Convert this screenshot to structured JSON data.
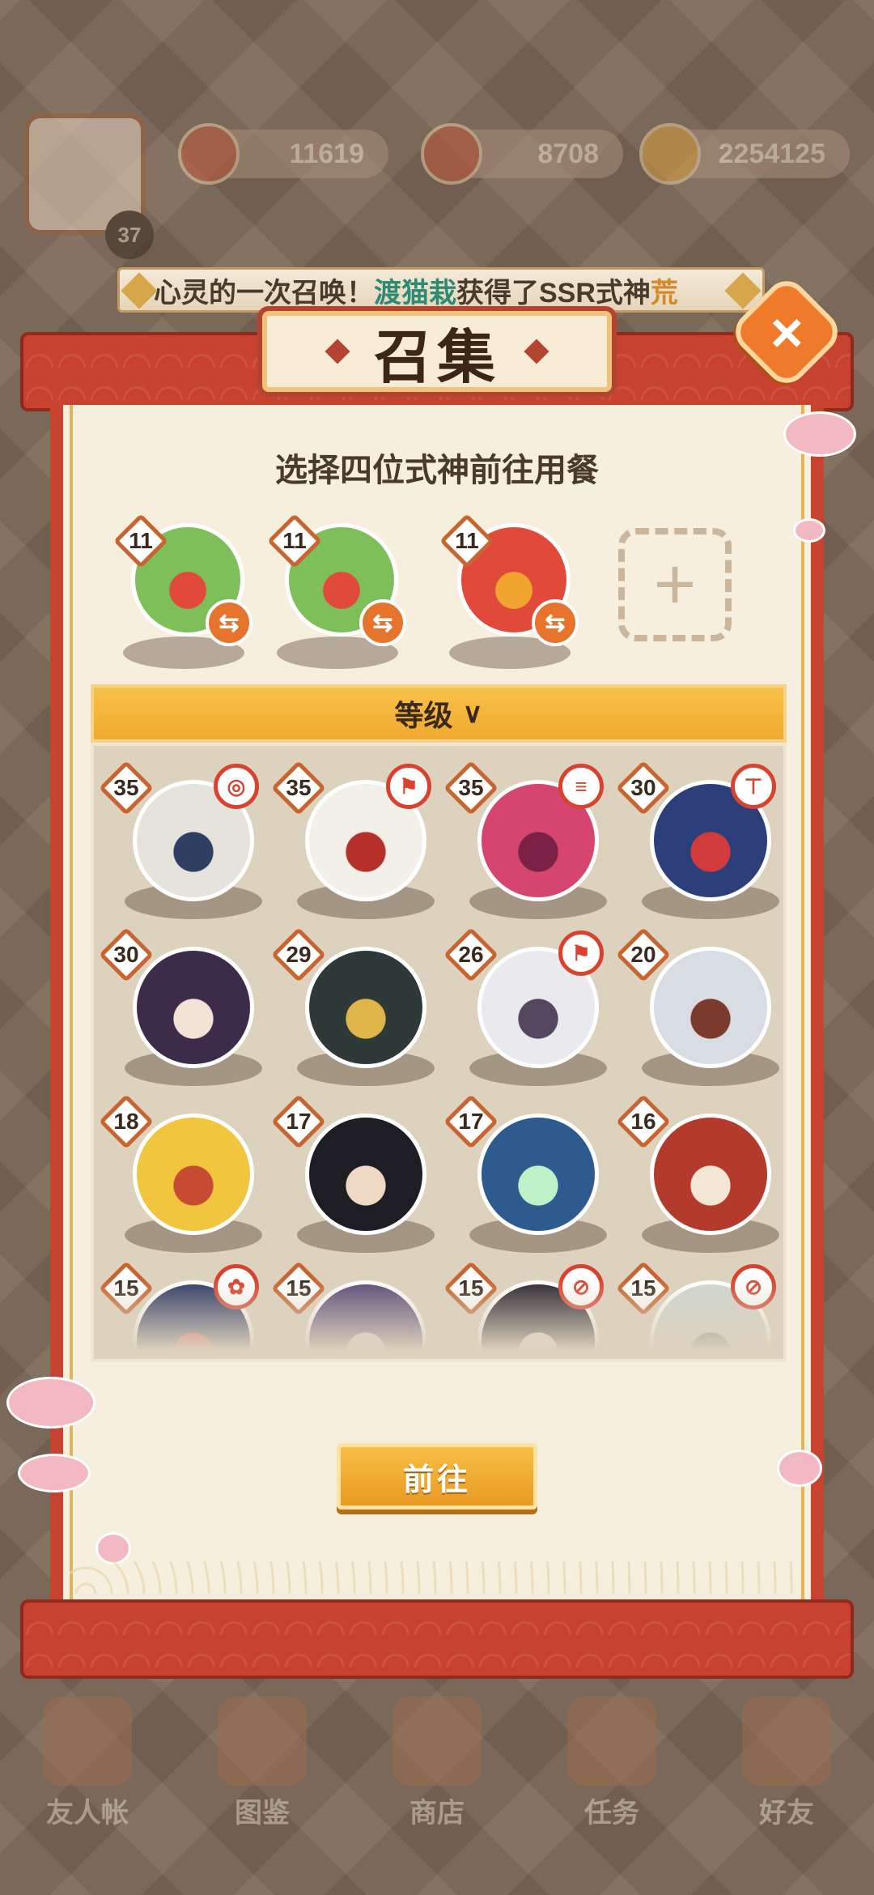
{
  "hud": {
    "level": "37",
    "currency_1": "11619",
    "currency_2": "8708",
    "currency_3": "2254125"
  },
  "ticker": {
    "prefix": "心灵的一次召唤！",
    "player": "渡猫栽",
    "middle": "获得了SSR式神",
    "suffix": "荒"
  },
  "dialog": {
    "title": "召集",
    "subtitle": "选择四位式神前往用餐",
    "close": "×",
    "sort_label": "等级",
    "sort_chevron": "∨",
    "go_button": "前往"
  },
  "team": [
    {
      "level": "11",
      "color": "#7fbf5a",
      "accent": "#e14a3a"
    },
    {
      "level": "11",
      "color": "#7fbf5a",
      "accent": "#e14a3a"
    },
    {
      "level": "11",
      "color": "#e14a3a",
      "accent": "#f2a431"
    }
  ],
  "add_slot": "+",
  "swap_glyph": "⇆",
  "roster": [
    {
      "level": "35",
      "role": "◎",
      "color": "#e6e2dc",
      "accent": "#2e3f62"
    },
    {
      "level": "35",
      "role": "⚑",
      "color": "#f3f0ea",
      "accent": "#b6302a"
    },
    {
      "level": "35",
      "role": "≡",
      "color": "#d5456f",
      "accent": "#7a2145"
    },
    {
      "level": "30",
      "role": "⊤",
      "color": "#2c3f7a",
      "accent": "#d23b3b"
    },
    {
      "level": "30",
      "role": "",
      "color": "#3d2b4a",
      "accent": "#f2e3d6"
    },
    {
      "level": "29",
      "role": "",
      "color": "#2d3a38",
      "accent": "#e0b64a"
    },
    {
      "level": "26",
      "role": "⚑",
      "color": "#e9e9ee",
      "accent": "#54465e"
    },
    {
      "level": "20",
      "role": "",
      "color": "#d8dde3",
      "accent": "#7b3a2c"
    },
    {
      "level": "18",
      "role": "",
      "color": "#f2c53f",
      "accent": "#c84a33"
    },
    {
      "level": "17",
      "role": "",
      "color": "#1f1d24",
      "accent": "#f0d9c4"
    },
    {
      "level": "17",
      "role": "",
      "color": "#2d5a8f",
      "accent": "#bff2c8"
    },
    {
      "level": "16",
      "role": "",
      "color": "#b43a2c",
      "accent": "#f3e6d4"
    },
    {
      "level": "15",
      "role": "✿",
      "color": "#2f3a66",
      "accent": "#d9463a"
    },
    {
      "level": "15",
      "role": "",
      "color": "#5c4b7a",
      "accent": "#d9cfe0"
    },
    {
      "level": "15",
      "role": "⊘",
      "color": "#2a2430",
      "accent": "#e6e0dd"
    },
    {
      "level": "15",
      "role": "⊘",
      "color": "#cfd6cf",
      "accent": "#6a7d6f"
    }
  ],
  "nav": [
    "友人帐",
    "图鉴",
    "商店",
    "任务",
    "好友"
  ]
}
